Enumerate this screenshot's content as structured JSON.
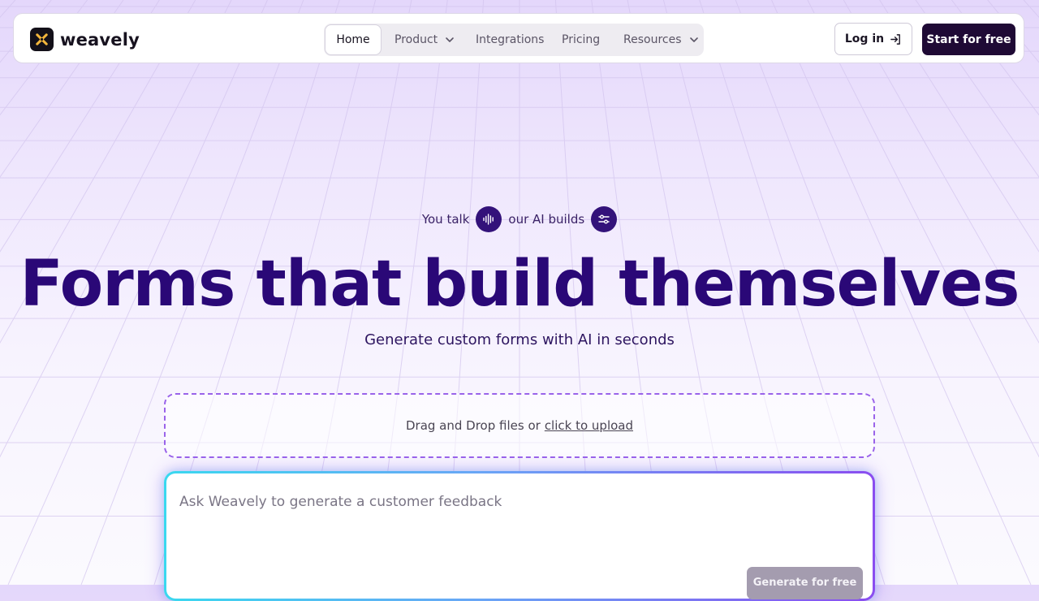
{
  "brand": {
    "name": "weavely"
  },
  "nav": {
    "items": [
      {
        "label": "Home",
        "active": true
      },
      {
        "label": "Product",
        "has_dropdown": true
      },
      {
        "label": "Integrations"
      },
      {
        "label": "Pricing"
      },
      {
        "label": "Resources",
        "has_dropdown": true
      }
    ]
  },
  "actions": {
    "login_label": "Log in",
    "start_label": "Start for free"
  },
  "hero": {
    "tagline_part1": "You talk",
    "tagline_part2": "our AI builds",
    "headline": "Forms that build themselves",
    "subheadline": "Generate custom forms with AI in seconds"
  },
  "upload": {
    "text": "Drag and Drop files or",
    "link_label": "click to upload"
  },
  "prompt": {
    "placeholder": "Ask Weavely to generate a customer feedback",
    "value": "",
    "generate_label": "Generate for free"
  },
  "icons": {
    "logo": "weavely-logo-icon",
    "dropdown": "chevron-down-icon",
    "login": "log-in-arrow-icon",
    "voice": "audio-waveform-icon",
    "builds": "settings-sliders-icon"
  },
  "colors": {
    "headline": "#2a0877",
    "primary_button": "#1f0a35",
    "tag_icon_bg": "#33127a",
    "dropzone_border": "#9a63ea",
    "generate_button": "#a49caf"
  }
}
